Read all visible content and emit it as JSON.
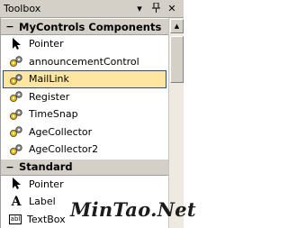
{
  "window": {
    "title": "Toolbox",
    "dropdown_icon": "dropdown-icon",
    "pin_icon": "pin-icon",
    "close_icon": "close-icon"
  },
  "categories": [
    {
      "name": "MyControls Components",
      "expanded": true,
      "items": [
        {
          "label": "Pointer",
          "icon": "pointer-icon",
          "selected": false
        },
        {
          "label": "announcementControl",
          "icon": "gear-component-icon",
          "selected": false
        },
        {
          "label": "MailLink",
          "icon": "gear-component-icon",
          "selected": true
        },
        {
          "label": "Register",
          "icon": "gear-component-icon",
          "selected": false
        },
        {
          "label": "TimeSnap",
          "icon": "gear-component-icon",
          "selected": false
        },
        {
          "label": "AgeCollector",
          "icon": "gear-component-icon",
          "selected": false
        },
        {
          "label": "AgeCollector2",
          "icon": "gear-component-icon",
          "selected": false
        }
      ]
    },
    {
      "name": "Standard",
      "expanded": true,
      "items": [
        {
          "label": "Pointer",
          "icon": "pointer-icon",
          "selected": false
        },
        {
          "label": "Label",
          "icon": "label-icon",
          "icon_text": "A",
          "selected": false
        },
        {
          "label": "TextBox",
          "icon": "textbox-icon",
          "icon_text": "abl",
          "selected": false
        }
      ]
    }
  ],
  "watermark": "MinTao.Net",
  "colors": {
    "selected_bg": "#ffe6a0",
    "selected_border": "#2b4a8a",
    "category_bg": "#d4d0c8"
  }
}
